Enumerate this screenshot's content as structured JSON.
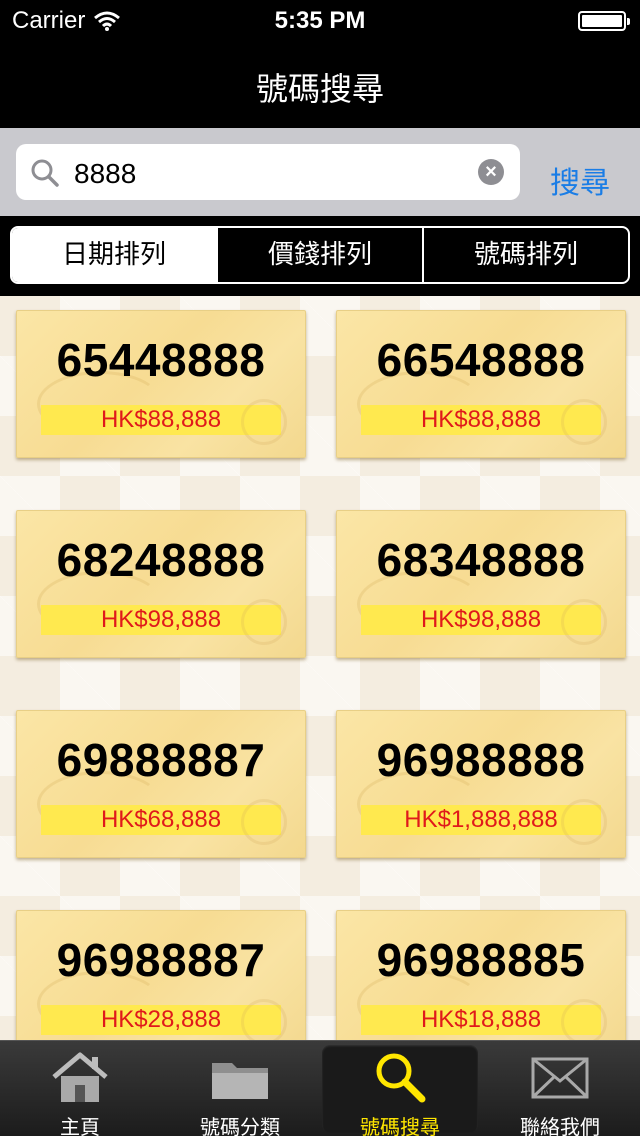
{
  "status_bar": {
    "carrier": "Carrier",
    "time": "5:35 PM"
  },
  "nav": {
    "title": "號碼搜尋"
  },
  "search": {
    "value": "8888",
    "button_label": "搜尋"
  },
  "sort_tabs": [
    {
      "label": "日期排列",
      "selected": true
    },
    {
      "label": "價錢排列",
      "selected": false
    },
    {
      "label": "號碼排列",
      "selected": false
    }
  ],
  "results": [
    {
      "number": "65448888",
      "price": "HK$88,888"
    },
    {
      "number": "66548888",
      "price": "HK$88,888"
    },
    {
      "number": "68248888",
      "price": "HK$98,888"
    },
    {
      "number": "68348888",
      "price": "HK$98,888"
    },
    {
      "number": "69888887",
      "price": "HK$68,888"
    },
    {
      "number": "96988888",
      "price": "HK$1,888,888"
    },
    {
      "number": "96988887",
      "price": "HK$28,888"
    },
    {
      "number": "96988885",
      "price": "HK$18,888"
    }
  ],
  "tab_bar": [
    {
      "label": "主頁",
      "icon": "home-icon",
      "selected": false
    },
    {
      "label": "號碼分類",
      "icon": "folder-icon",
      "selected": false
    },
    {
      "label": "號碼搜尋",
      "icon": "search-icon",
      "selected": true
    },
    {
      "label": "聯絡我們",
      "icon": "mail-icon",
      "selected": false
    }
  ],
  "colors": {
    "accent": "#1a7de6",
    "price_text": "#e0191b",
    "price_bg": "#ffe94f",
    "active_tab": "#ffe600"
  }
}
